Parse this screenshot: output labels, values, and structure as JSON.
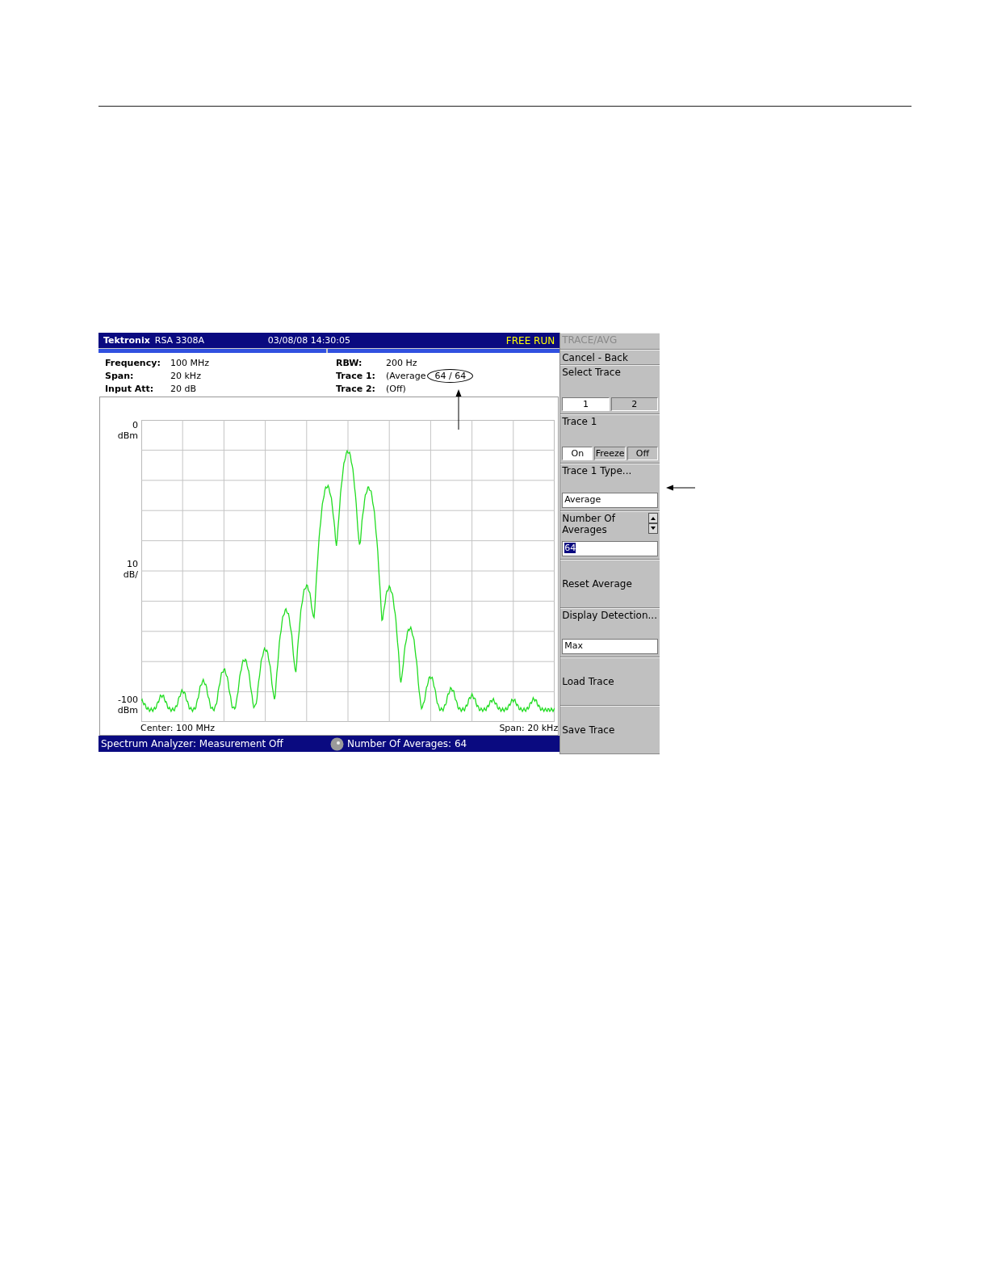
{
  "header": {
    "brand": "Tektronix",
    "model": "RSA 3308A",
    "datetime": "03/08/08 14:30:05",
    "run_status": "FREE RUN"
  },
  "readouts_left": [
    {
      "label": "Frequency:",
      "value": "100 MHz"
    },
    {
      "label": "Span:",
      "value": "20 kHz"
    },
    {
      "label": "Input Att:",
      "value": "20 dB"
    }
  ],
  "readouts_right": [
    {
      "label": "RBW:",
      "value": "200 Hz"
    },
    {
      "label": "Trace 1:",
      "value": "(Average",
      "count": "64 / 64"
    },
    {
      "label": "Trace 2:",
      "value": "(Off)"
    }
  ],
  "graph": {
    "y_labels": [
      {
        "value": "0",
        "unit": "dBm"
      },
      {
        "value": "10",
        "unit": "dB/"
      },
      {
        "value": "-100",
        "unit": "dBm"
      }
    ],
    "center": "Center: 100 MHz",
    "span": "Span: 20 kHz"
  },
  "status_bar": {
    "mode": "Spectrum Analyzer: Measurement Off",
    "knob_readout": "Number Of Averages: 64"
  },
  "softkeys": [
    {
      "kind": "title",
      "label": "TRACE/AVG",
      "disabled": true
    },
    {
      "kind": "action",
      "label": "Cancel - Back"
    },
    {
      "kind": "toggle",
      "label": "Select Trace",
      "options": [
        {
          "label": "1",
          "selected": true
        },
        {
          "label": "2",
          "selected": false
        }
      ]
    },
    {
      "kind": "toggle",
      "label": "Trace 1",
      "options": [
        {
          "label": "On",
          "selected": true
        },
        {
          "label": "Freeze",
          "selected": false
        },
        {
          "label": "Off",
          "selected": false
        }
      ]
    },
    {
      "kind": "field",
      "label": "Trace 1 Type...",
      "value": "Average"
    },
    {
      "kind": "spin",
      "label": "Number Of Averages",
      "value": "64",
      "value_selected": true
    },
    {
      "kind": "action",
      "label": "Reset Average"
    },
    {
      "kind": "field",
      "label": "Display Detection...",
      "value": "Max"
    },
    {
      "kind": "action",
      "label": "Load Trace"
    },
    {
      "kind": "action",
      "label": "Save Trace"
    }
  ]
}
